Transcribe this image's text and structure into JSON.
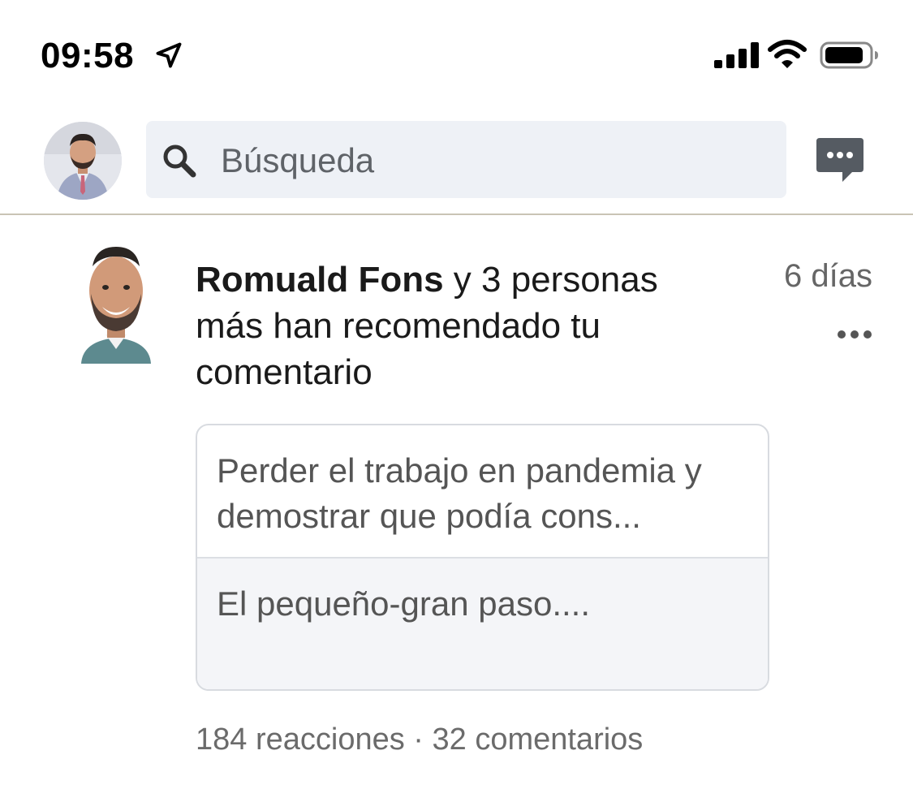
{
  "status_bar": {
    "time": "09:58",
    "icons": [
      "location-arrow-icon",
      "signal-icon",
      "wifi-icon",
      "battery-icon"
    ]
  },
  "header": {
    "search_placeholder": "Búsqueda",
    "icons": [
      "search-icon",
      "messaging-icon"
    ]
  },
  "notification": {
    "actor_name": "Romuald Fons",
    "text_rest": " y 3 personas más han recomendado tu comentario",
    "time": "6 días",
    "post": {
      "snippet": "Perder el trabajo en pandemia y demostrar que podía cons...",
      "title": "El pequeño-gran paso...."
    },
    "stats": "184 reacciones · 32 comentarios"
  },
  "colors": {
    "search_bg": "#eef1f6",
    "secondary_text": "#666666",
    "card_border": "#d8dbe0"
  }
}
